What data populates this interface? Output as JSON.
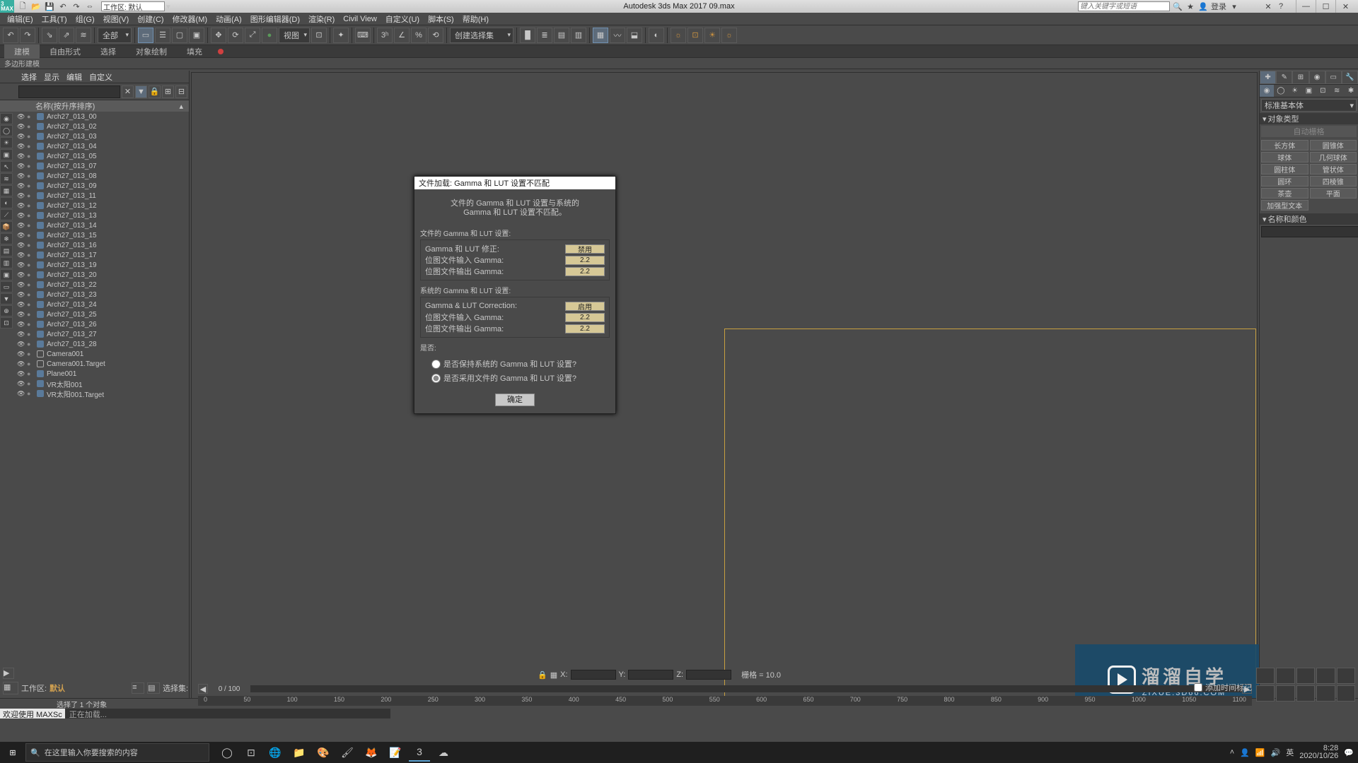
{
  "title": "Autodesk 3ds Max 2017    09.max",
  "workspace_label": "工作区: 默认",
  "search_placeholder": "键入关键字或短语",
  "login_label": "登录",
  "menus": [
    "编辑(E)",
    "工具(T)",
    "组(G)",
    "视图(V)",
    "创建(C)",
    "修改器(M)",
    "动画(A)",
    "图形编辑器(D)",
    "渲染(R)",
    "Civil View",
    "自定义(U)",
    "脚本(S)",
    "帮助(H)"
  ],
  "filter_all": "全部",
  "view_drop": "视图",
  "create_sel": "创建选择集",
  "ribbon": {
    "tabs": [
      "建模",
      "自由形式",
      "选择",
      "对象绘制",
      "填充"
    ],
    "active": 0,
    "sub": "多边形建模"
  },
  "explorer": {
    "tabs": [
      "选择",
      "显示",
      "编辑",
      "自定义"
    ],
    "header": "名称(按升序排序)",
    "items": [
      "Arch27_013_00",
      "Arch27_013_02",
      "Arch27_013_03",
      "Arch27_013_04",
      "Arch27_013_05",
      "Arch27_013_07",
      "Arch27_013_08",
      "Arch27_013_09",
      "Arch27_013_11",
      "Arch27_013_12",
      "Arch27_013_13",
      "Arch27_013_14",
      "Arch27_013_15",
      "Arch27_013_16",
      "Arch27_013_17",
      "Arch27_013_19",
      "Arch27_013_20",
      "Arch27_013_22",
      "Arch27_013_23",
      "Arch27_013_24",
      "Arch27_013_25",
      "Arch27_013_26",
      "Arch27_013_27",
      "Arch27_013_28",
      "Camera001",
      "Camera001.Target",
      "Plane001",
      "VR太阳001",
      "VR太阳001.Target"
    ]
  },
  "cmd": {
    "category": "标准基本体",
    "rollout1": "对象类型",
    "autogrid": "自动栅格",
    "prims": [
      "长方体",
      "圆锥体",
      "球体",
      "几何球体",
      "圆柱体",
      "管状体",
      "圆环",
      "四棱锥",
      "茶壶",
      "平面",
      "加强型文本",
      ""
    ],
    "rollout2": "名称和颜色"
  },
  "dialog": {
    "title": "文件加载: Gamma 和 LUT 设置不匹配",
    "msg1": "文件的 Gamma 和 LUT 设置与系统的",
    "msg2": "Gamma 和 LUT 设置不匹配。",
    "grp1_hdr": "文件的 Gamma 和 LUT 设置:",
    "row_correction": "Gamma 和 LUT  修正:",
    "val_disable": "禁用",
    "row_in": "位图文件输入 Gamma:",
    "row_out": "位图文件输出 Gamma:",
    "val_22": "2.2",
    "grp2_hdr": "系统的 Gamma 和 LUT 设置:",
    "row_correction2": "Gamma & LUT Correction:",
    "val_enable": "启用",
    "q_hdr": "是否:",
    "opt1": "是否保持系统的 Gamma 和 LUT 设置?",
    "opt2": "是否采用文件的 Gamma 和 LUT 设置?",
    "ok": "确定"
  },
  "track": {
    "workspace": "工作区: ",
    "ws_val": "默认",
    "selset": "选择集:",
    "frame": "0 / 100"
  },
  "status": {
    "sel": "选择了 1 个对象",
    "welcome": "欢迎使用 MAXSc",
    "loading": "正在加载...",
    "grid": "栅格 = 10.0",
    "timetag": "添加时间标记"
  },
  "coords": {
    "x": "X:",
    "y": "Y:",
    "z": "Z:"
  },
  "ruler": [
    "0",
    "50",
    "100",
    "150",
    "200",
    "250",
    "300",
    "350",
    "400",
    "450",
    "500",
    "550",
    "600",
    "650",
    "700",
    "750",
    "800",
    "850",
    "900",
    "950",
    "1000",
    "1050",
    "1100"
  ],
  "watermark": {
    "brand": "溜溜自学",
    "url": "ZIXUE.3D66.COM"
  },
  "taskbar": {
    "search": "在这里输入你要搜索的内容",
    "time": "8:28",
    "date": "2020/10/26"
  }
}
